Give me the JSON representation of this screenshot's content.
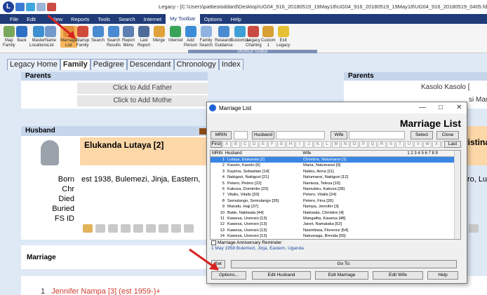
{
  "window": {
    "title": "Legacy - [C:\\Users\\pattiestoddard\\Desktop\\UG04_916_20180519_19May18\\UG04_916_20180519_19May18\\UG04_916_20180519_0405.fdb]",
    "app_logo": "L"
  },
  "menu": [
    "File",
    "Edit",
    "View",
    "Reports",
    "Tools",
    "Search",
    "Internet",
    "My Toolbar",
    "Options",
    "Help"
  ],
  "ribbon": {
    "tools": [
      {
        "label": "Map",
        "label2": "Family",
        "icon": "map-icon"
      },
      {
        "label": "Back",
        "label2": "",
        "icon": "back-icon"
      },
      {
        "label": "Master",
        "label2": "Locations",
        "icon": "master-locations-icon"
      },
      {
        "label": "Name",
        "label2": "List",
        "icon": "name-list-icon"
      },
      {
        "label": "Marriage",
        "label2": "List",
        "icon": "marriage-list-icon"
      },
      {
        "label": "Startup",
        "label2": "Family",
        "icon": "startup-family-icon"
      },
      {
        "label": "Search",
        "label2": "",
        "icon": "search-icon"
      },
      {
        "label": "Search",
        "label2": "Results",
        "icon": "search-results-icon"
      },
      {
        "label": "Report",
        "label2": "Menu",
        "icon": "report-menu-icon"
      },
      {
        "label": "Last",
        "label2": "Report",
        "icon": "last-report-icon"
      },
      {
        "label": "Merge",
        "label2": "",
        "icon": "merge-icon"
      },
      {
        "label": "Internet",
        "label2": "",
        "icon": "internet-icon"
      },
      {
        "label": "Add",
        "label2": "Person",
        "icon": "add-person-icon"
      },
      {
        "label": "Family",
        "label2": "Search",
        "icon": "family-search-icon"
      },
      {
        "label": "Research",
        "label2": "Guidance",
        "icon": "research-guidance-icon"
      },
      {
        "label": "Customize",
        "label2": "",
        "icon": "customize-icon"
      },
      {
        "label": "Legacy",
        "label2": "Charting",
        "icon": "legacy-charting-icon"
      },
      {
        "label": "Custom",
        "label2": "1",
        "icon": "custom-icon"
      },
      {
        "label": "Exit",
        "label2": "Legacy",
        "icon": "exit-icon"
      }
    ],
    "shortcut_label": "Shortcut Toolbar"
  },
  "view_tabs": [
    "Legacy Home",
    "Family",
    "Pedigree",
    "Descendant",
    "Chronology",
    "Index"
  ],
  "family": {
    "parents_label": "Parents",
    "add_father": "Click to Add Father",
    "add_mother": "Click to Add Mothe",
    "husband_label": "Husband",
    "husband_name": "Elukanda Lutaya [2]",
    "events": [
      "Born",
      "Chr",
      "Died",
      "Buried",
      "FS ID"
    ],
    "born_value": "est 1938, Bulemezi, Jinja, Eastern,",
    "marriage_label": "Marriage",
    "child_num": "1",
    "child_text": "Jennifer Nampa [3] (est 1959-)+",
    "right_parents_label": "Parents",
    "right_father": "Kasolo Kasolo [",
    "right_mother": "si Mar",
    "right_spouse": "ristina",
    "right_born": "ro, Luv"
  },
  "dialog": {
    "title": "Marriage List",
    "heading": "Marriage List",
    "buttons": {
      "mrin": "MRIN",
      "husband": "Husband",
      "wife": "Wife",
      "select": "Select",
      "close": "Close",
      "first": "First",
      "last": "Last",
      "set": "Set",
      "goto": "Go To:",
      "options": "Options...",
      "edit_husband": "Edit Husband",
      "edit_marriage": "Edit Marriage",
      "edit_wife": "Edit Wife",
      "help": "Help"
    },
    "letters": [
      "A",
      "B",
      "C",
      "D",
      "E",
      "F",
      "G",
      "H",
      "I",
      "J",
      "K",
      "L",
      "M",
      "N",
      "O",
      "P",
      "Q",
      "R",
      "S",
      "T",
      "U",
      "V",
      "W",
      "X",
      "Y",
      "Z"
    ],
    "columns": [
      "MRIN",
      "Husband",
      "Wife",
      "1 2 3 4 5 6 7 8 9"
    ],
    "rows": [
      {
        "mrin": "1",
        "husband": "Lutaya, Elukanda [2]",
        "wife": "Christine, Nalumansi [1]"
      },
      {
        "mrin": "2",
        "husband": "Kasolo, Kasolo [6]",
        "wife": "Maria, Nalumansi [9]"
      },
      {
        "mrin": "3",
        "husband": "Kayima, Sebastian [14]",
        "wife": "Nakku, Anna [11]"
      },
      {
        "mrin": "4",
        "husband": "Nakigozi, Nakigozi [21]",
        "wife": "Nalumansi, Nakigozi [12]"
      },
      {
        "mrin": "5",
        "husband": "Petero, Petero [22]",
        "wife": "Nanteza, Teleza [10]"
      },
      {
        "mrin": "6",
        "husband": "Kakoza, Dominiko [23]",
        "wife": "Namubiru, Kakoza [28]"
      },
      {
        "mrin": "7",
        "husband": "Vitalis, Vitalis [33]",
        "wife": "Petero, Vitalis [24]"
      },
      {
        "mrin": "8",
        "husband": "Semulango, Semulango [35]",
        "wife": "Petero, Fina [26]"
      },
      {
        "mrin": "9",
        "husband": "Munafu, Haji [37]",
        "wife": "Nampa, Jennifer [3]"
      },
      {
        "mrin": "10",
        "husband": "Batte, Nakiwala [44]",
        "wife": "Nakiwala, Christine [4]"
      },
      {
        "mrin": "11",
        "husband": "Kawesa, Uvensio [13]",
        "wife": "Mangalita, Kawesa [48]"
      },
      {
        "mrin": "12",
        "husband": "Kawesa, Uvensio [13]",
        "wife": "Janet, Namataka [52]"
      },
      {
        "mrin": "13",
        "husband": "Kawesa, Uvensio [13]",
        "wife": "Nasimbwa, Florence [54]"
      },
      {
        "mrin": "14",
        "husband": "Kawesa, Uvensio [13]",
        "wife": "Nakuwaga, Brenda [55]"
      }
    ],
    "anniversary_label": "Marriage Anniversary Reminder",
    "place_text": "1 May 1958 Bulemezi, Jinja, Eastern, Uganda",
    "minimize": "—",
    "maximize": "□",
    "close_x": "✕"
  }
}
